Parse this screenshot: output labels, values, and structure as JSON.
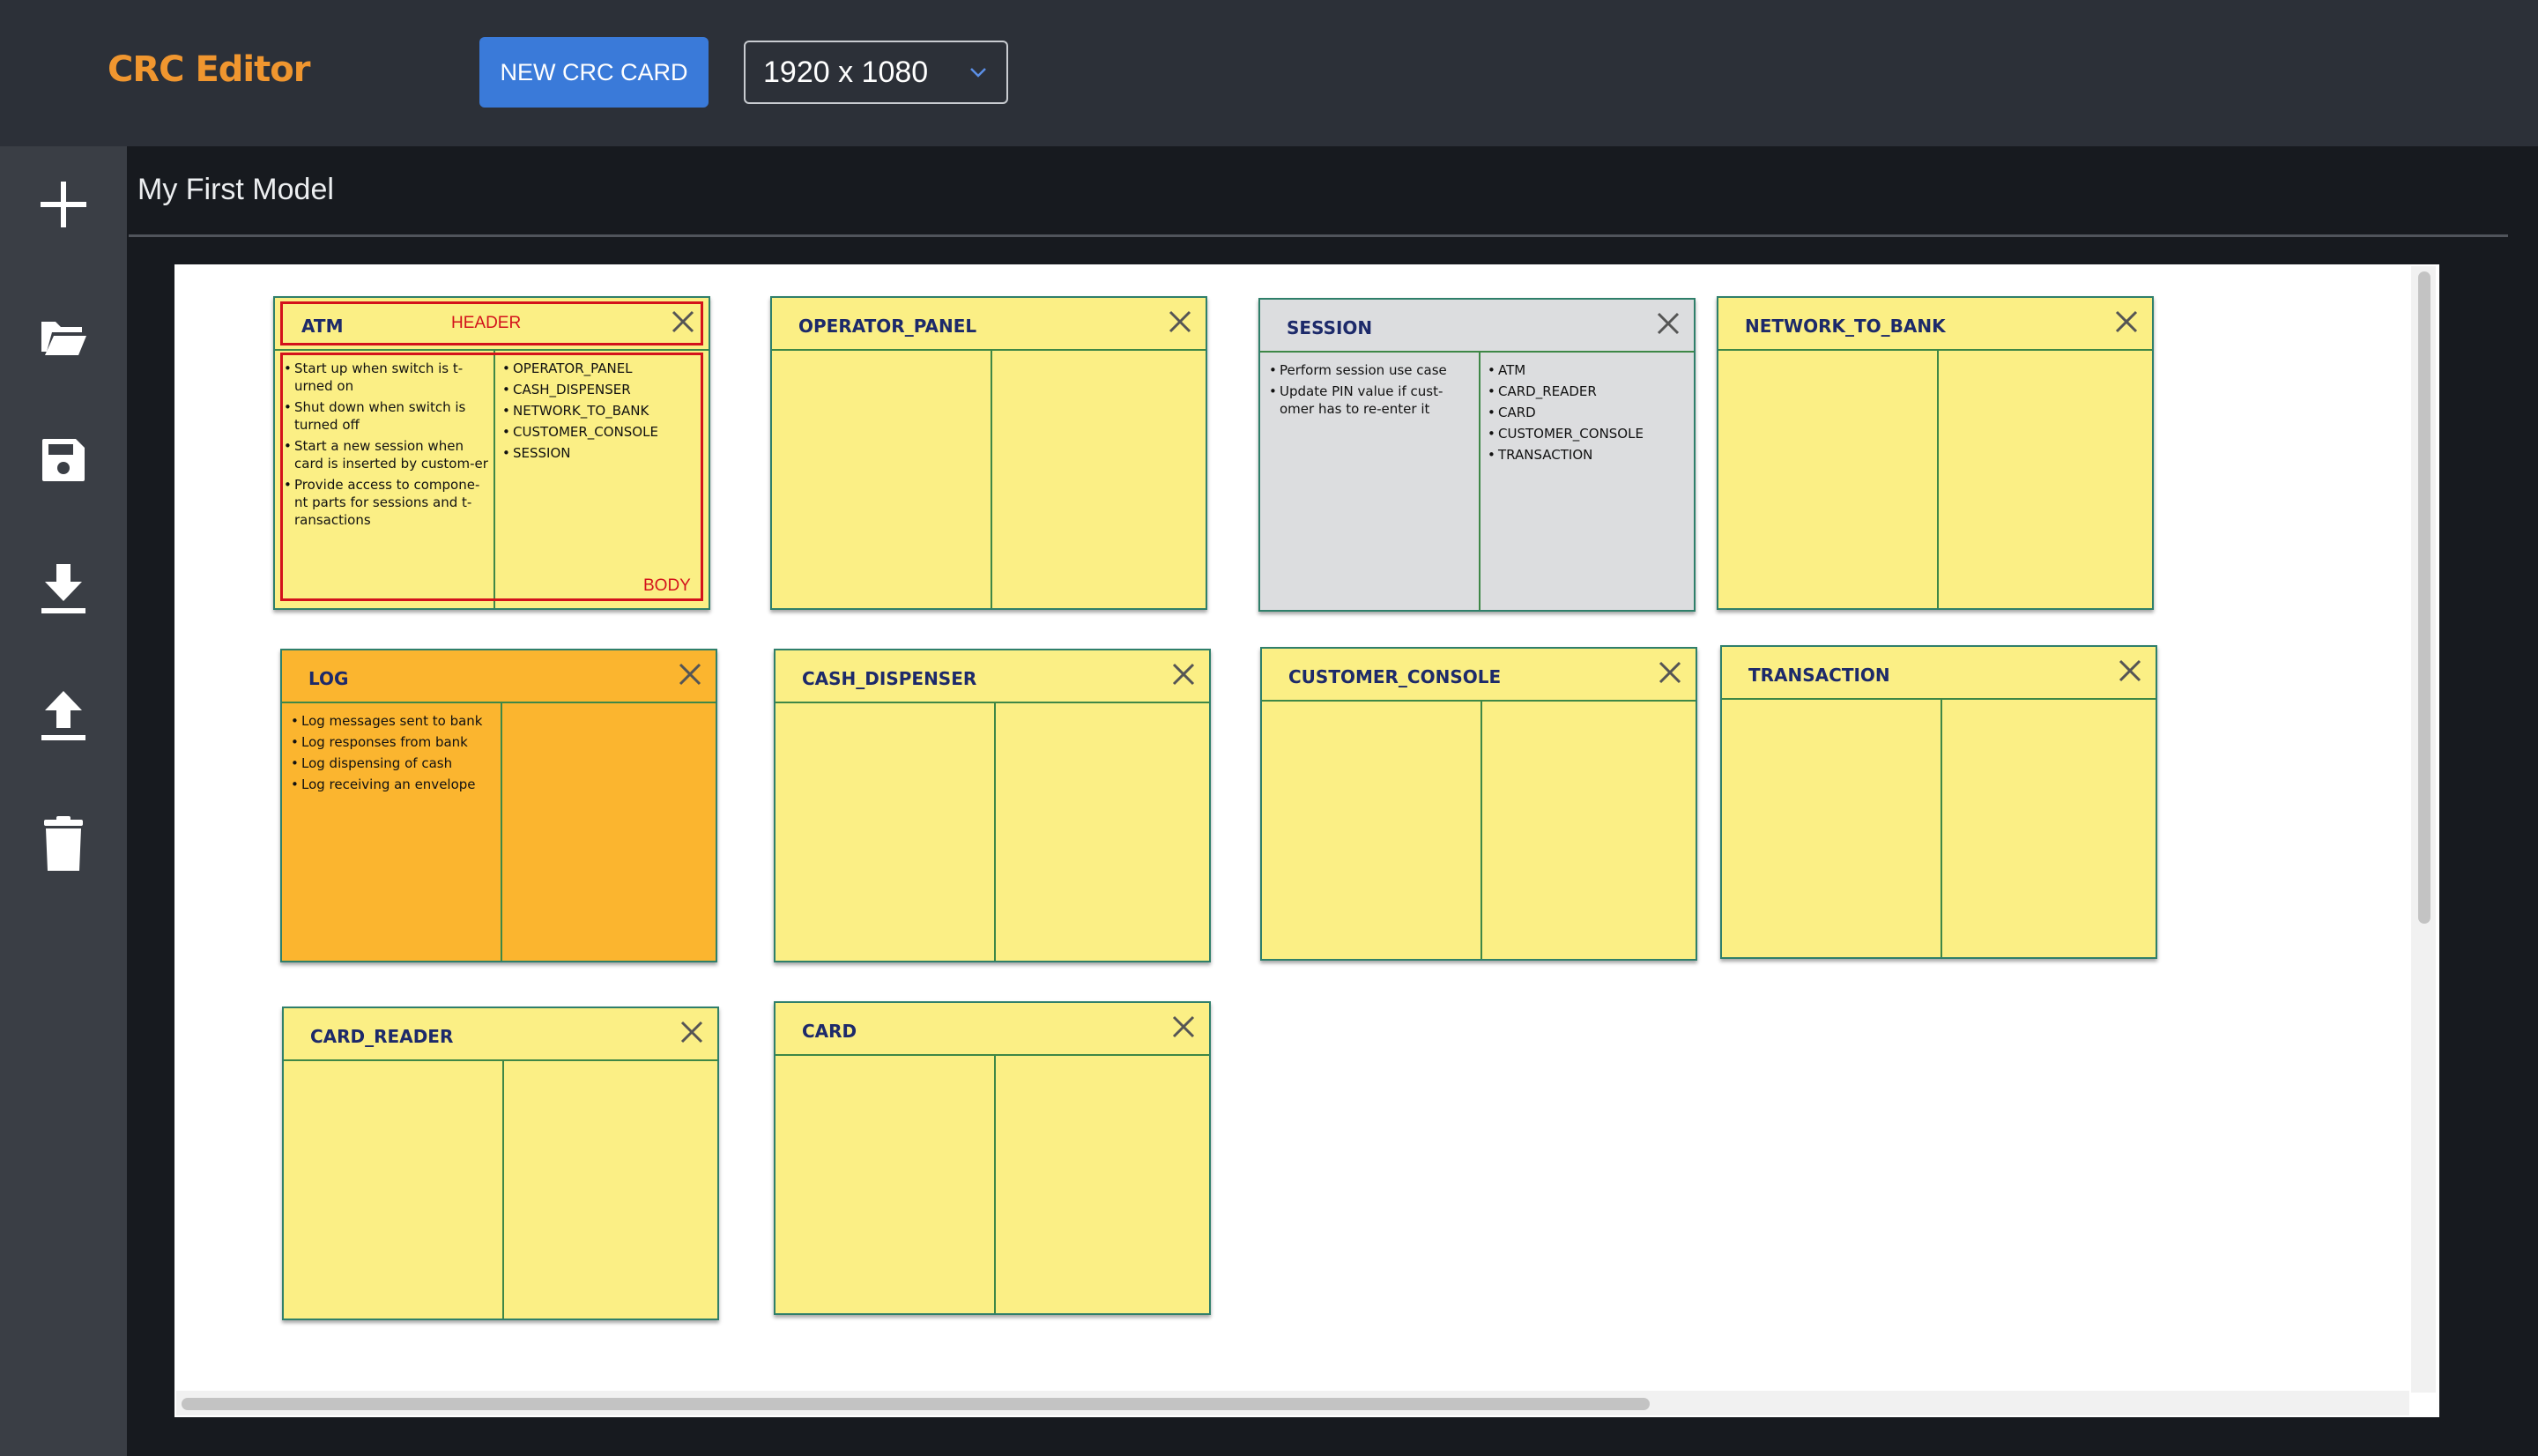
{
  "app": {
    "title": "CRC Editor"
  },
  "toolbar": {
    "new_card_label": "NEW CRC CARD",
    "resolution": "1920 x 1080"
  },
  "sidebar": {
    "items": [
      {
        "icon": "plus-icon",
        "action": "add"
      },
      {
        "icon": "folder-open-icon",
        "action": "open"
      },
      {
        "icon": "save-icon",
        "action": "save"
      },
      {
        "icon": "download-icon",
        "action": "export"
      },
      {
        "icon": "upload-icon",
        "action": "import"
      },
      {
        "icon": "trash-icon",
        "action": "delete"
      }
    ]
  },
  "model": {
    "title": "My First Model"
  },
  "annotations": {
    "header_label": "HEADER",
    "body_label": "BODY"
  },
  "cards": [
    {
      "name": "ATM",
      "color": "#fbef85",
      "responsibilities": [
        "Start up when switch is t-urned on",
        "Shut down when switch is turned off",
        "Start a new session when card is inserted by custom-er",
        "Provide access to compone-nt parts for sessions and t-ransactions"
      ],
      "collaborators": [
        "OPERATOR_PANEL",
        "CASH_DISPENSER",
        "NETWORK_TO_BANK",
        "CUSTOMER_CONSOLE",
        "SESSION"
      ]
    },
    {
      "name": "OPERATOR_PANEL",
      "color": "#fbef85",
      "responsibilities": [],
      "collaborators": []
    },
    {
      "name": "SESSION",
      "color": "#dcdddf",
      "responsibilities": [
        "Perform session use case",
        "Update PIN value if cust-omer has to re-enter it"
      ],
      "collaborators": [
        "ATM",
        "CARD_READER",
        "CARD",
        "CUSTOMER_CONSOLE",
        "TRANSACTION"
      ]
    },
    {
      "name": "NETWORK_TO_BANK",
      "color": "#fbef85",
      "responsibilities": [],
      "collaborators": []
    },
    {
      "name": "LOG",
      "color": "#fbb52f",
      "responsibilities": [
        "Log messages sent to bank",
        "Log responses from bank",
        "Log dispensing of cash",
        "Log receiving an envelope"
      ],
      "collaborators": []
    },
    {
      "name": "CASH_DISPENSER",
      "color": "#fbef85",
      "responsibilities": [],
      "collaborators": []
    },
    {
      "name": "CUSTOMER_CONSOLE",
      "color": "#fbef85",
      "responsibilities": [],
      "collaborators": []
    },
    {
      "name": "TRANSACTION",
      "color": "#fbef85",
      "responsibilities": [],
      "collaborators": []
    },
    {
      "name": "CARD_READER",
      "color": "#fbef85",
      "responsibilities": [],
      "collaborators": []
    },
    {
      "name": "CARD",
      "color": "#fbef85",
      "responsibilities": [],
      "collaborators": []
    }
  ]
}
